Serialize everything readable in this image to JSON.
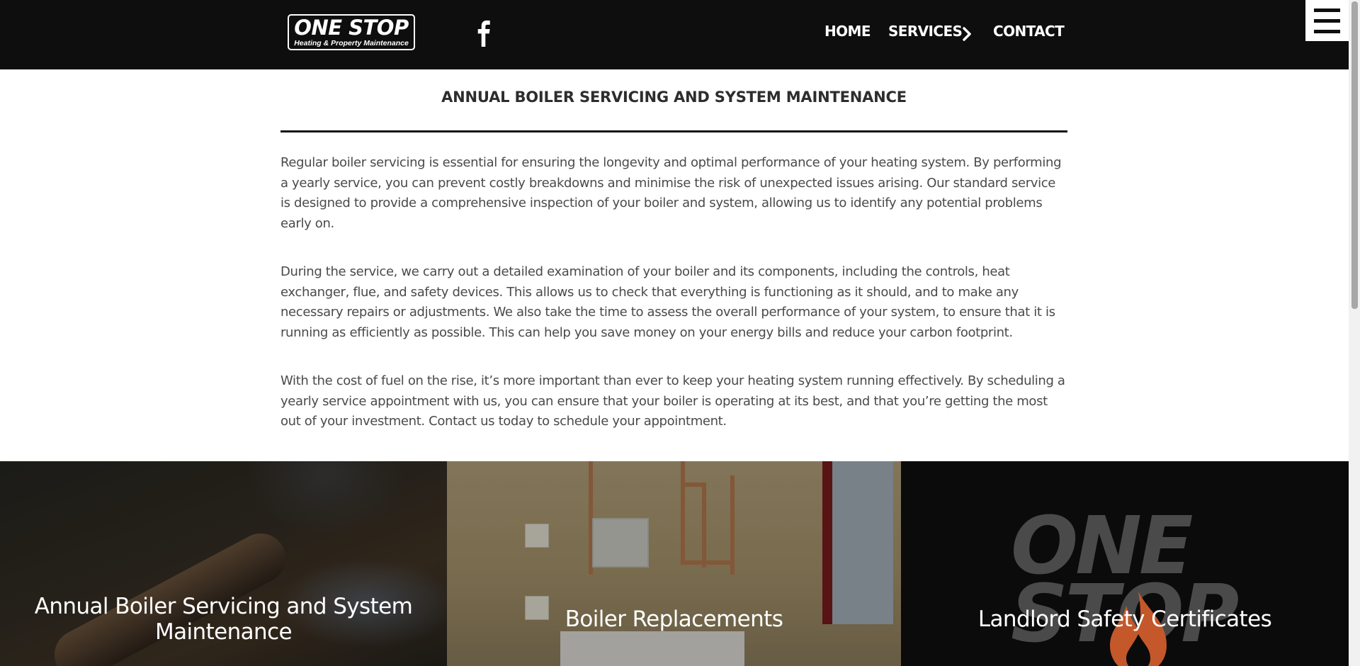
{
  "header": {
    "logo": {
      "main": "ONE STOP",
      "sub": "Heating & Property Maintenance"
    },
    "social_icon": "facebook-icon",
    "nav": [
      {
        "label": "HOME"
      },
      {
        "label": "SERVICES",
        "icon": "chevron-right-icon"
      },
      {
        "label": "CONTACT"
      }
    ],
    "menu_icon": "hamburger-icon"
  },
  "main": {
    "title": "ANNUAL BOILER SERVICING AND SYSTEM MAINTENANCE",
    "paragraphs": [
      "Regular boiler servicing is essential for ensuring the longevity and optimal performance of your heating system. By performing a yearly service, you can prevent costly breakdowns and minimise the risk of unexpected issues arising. Our standard service is designed to provide a comprehensive inspection of your boiler and system, allowing us to identify any potential problems early on.",
      "During the service, we carry out a detailed examination of your boiler and its components, including the controls, heat exchanger, flue, and safety devices. This allows us to check that everything is functioning as it should, and to make any necessary repairs or adjustments. We also take the time to assess the overall performance of your system, to ensure that it is running as efficiently as possible. This can help you save money on your energy bills and reduce your carbon footprint.",
      "With the cost of fuel on the rise, it’s more important than ever to keep your heating system running effectively. By scheduling a yearly service appointment with us, you can ensure that your boiler is operating at its best, and that you’re getting the most out of your investment. Contact us today to schedule your appointment."
    ]
  },
  "cards": [
    {
      "title": "Annual Boiler Servicing and System Maintenance"
    },
    {
      "title": "Boiler Replacements"
    },
    {
      "title": "Landlord Safety Certificates",
      "logo_text_1": "ONE",
      "logo_text_2": "STOP"
    }
  ],
  "colors": {
    "header_bg": "#0e0e0e",
    "text": "#4a4a4a",
    "title": "#2d2d2d",
    "flame": "#c4582a"
  }
}
